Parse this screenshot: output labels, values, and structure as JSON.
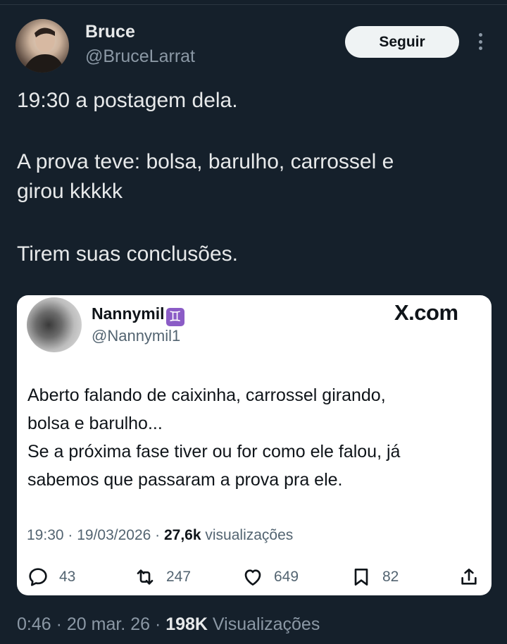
{
  "author": {
    "name": "Bruce",
    "handle": "@BruceLarrat",
    "follow_label": "Seguir",
    "more_icon": "more-vertical-icon"
  },
  "tweet": {
    "line1": "19:30 a postagem dela.",
    "line2": "A prova teve: bolsa, barulho, carrossel e",
    "line3": "girou kkkkk",
    "line4": "Tirem suas conclusões."
  },
  "quoted": {
    "name": "Nannymil",
    "emoji": "♊",
    "handle": "@Nannymil1",
    "brand": "X.com",
    "lines": [
      "Aberto falando de caixinha, carrossel girando,",
      "bolsa e barulho...",
      "Se a próxima fase tiver ou for como ele falou, já",
      "sabemos que passaram a prova pra ele."
    ],
    "time": "19:30 · 19/03/2026 · ",
    "views_count": "27,6k",
    "views_label": " visualizações",
    "replies": "43",
    "reposts": "247",
    "likes": "649",
    "bookmarks": "82"
  },
  "footer": {
    "time": "0:46 · 20 mar. 26 · ",
    "views_count": "198K",
    "views_label": " Visualizações"
  }
}
